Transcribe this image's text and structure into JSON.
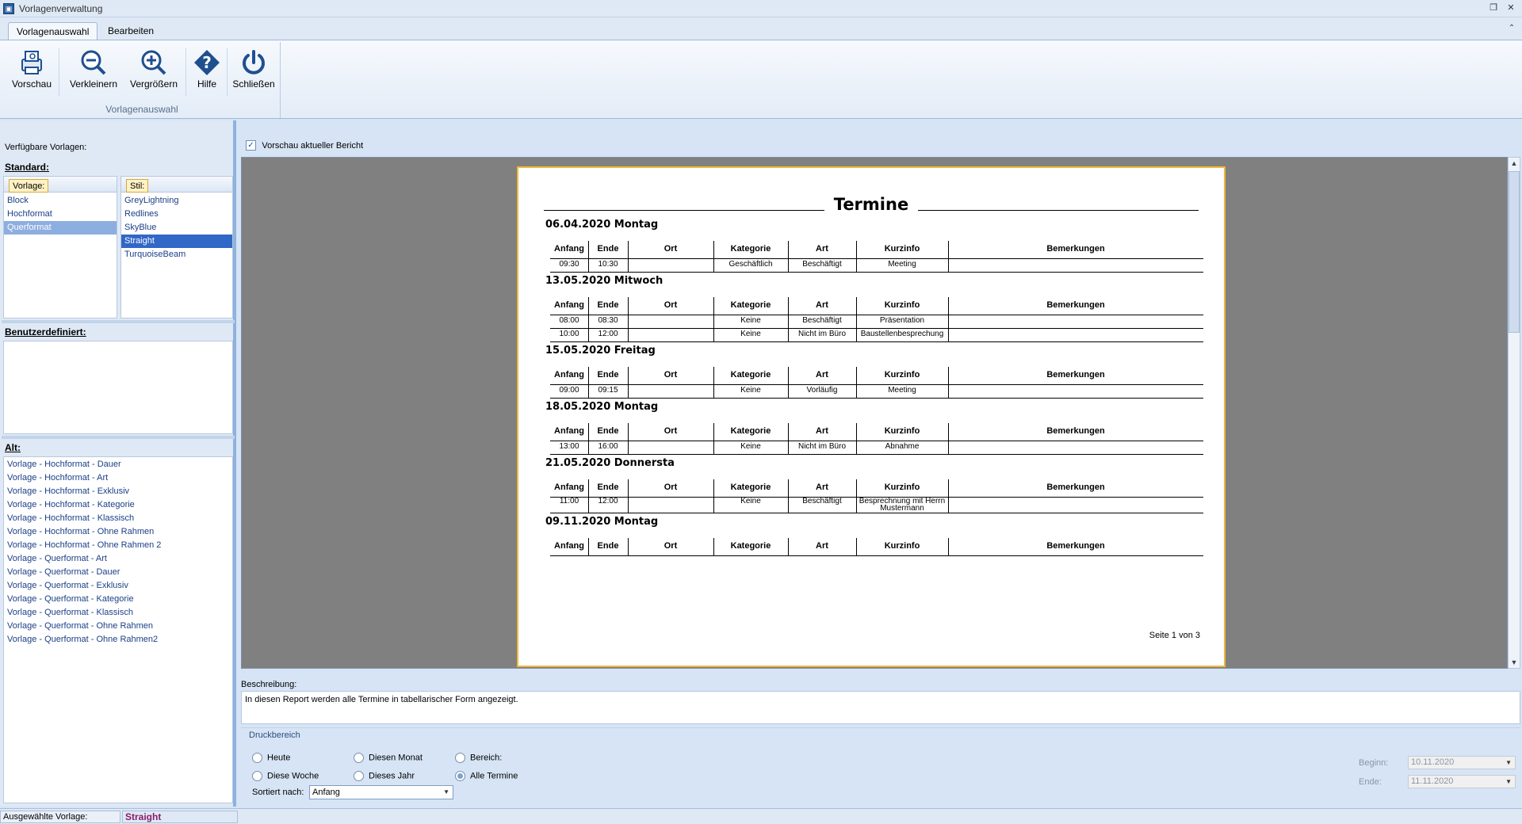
{
  "window": {
    "title": "Vorlagenverwaltung"
  },
  "tabs": [
    "Vorlagenauswahl",
    "Bearbeiten"
  ],
  "ribbon": {
    "buttons": [
      "Vorschau",
      "Verkleinern",
      "Vergrößern",
      "Hilfe",
      "Schließen"
    ],
    "group_label": "Vorlagenauswahl"
  },
  "left": {
    "available_label": "Verfügbare Vorlagen:",
    "standard_label": "Standard:",
    "vorlage_header": "Vorlage:",
    "stil_header": "Stil:",
    "vorlagen": [
      "Block",
      "Hochformat",
      "Querformat"
    ],
    "stile": [
      "GreyLightning",
      "Redlines",
      "SkyBlue",
      "Straight",
      "TurquoiseBeam"
    ],
    "custom_label": "Benutzerdefiniert:",
    "alt_label": "Alt:",
    "alt_items": [
      "Vorlage - Hochformat - Dauer",
      "Vorlage - Hochformat - Art",
      "Vorlage - Hochformat - Exklusiv",
      "Vorlage - Hochformat - Kategorie",
      "Vorlage - Hochformat - Klassisch",
      "Vorlage - Hochformat - Ohne Rahmen",
      "Vorlage - Hochformat - Ohne Rahmen 2",
      "Vorlage - Querformat - Art",
      "Vorlage - Querformat - Dauer",
      "Vorlage - Querformat - Exklusiv",
      "Vorlage - Querformat - Kategorie",
      "Vorlage - Querformat - Klassisch",
      "Vorlage - Querformat - Ohne Rahmen",
      "Vorlage - Querformat - Ohne Rahmen2"
    ]
  },
  "preview": {
    "checkbox_label": "Vorschau aktueller Bericht",
    "report": {
      "title": "Termine",
      "columns": [
        "Anfang",
        "Ende",
        "Ort",
        "Kategorie",
        "Art",
        "Kurzinfo",
        "Bemerkungen"
      ],
      "days": [
        {
          "date": "06.04.2020 Montag",
          "rows": [
            [
              "09:30",
              "10:30",
              "",
              "Geschäftlich",
              "Beschäftigt",
              "Meeting",
              ""
            ]
          ]
        },
        {
          "date": "13.05.2020 Mitwoch",
          "rows": [
            [
              "08:00",
              "08:30",
              "",
              "Keine",
              "Beschäftigt",
              "Präsentation",
              ""
            ],
            [
              "10:00",
              "12:00",
              "",
              "Keine",
              "Nicht im Büro",
              "Baustellenbesprechung",
              ""
            ]
          ]
        },
        {
          "date": "15.05.2020 Freitag",
          "rows": [
            [
              "09:00",
              "09:15",
              "",
              "Keine",
              "Vorläufig",
              "Meeting",
              ""
            ]
          ]
        },
        {
          "date": "18.05.2020 Montag",
          "rows": [
            [
              "13:00",
              "16:00",
              "",
              "Keine",
              "Nicht im Büro",
              "Abnahme",
              ""
            ]
          ]
        },
        {
          "date": "21.05.2020 Donnersta",
          "rows": [
            [
              "11:00",
              "12:00",
              "",
              "Keine",
              "Beschäftigt",
              "Besprechnung mit Herrn Mustermann",
              ""
            ]
          ]
        },
        {
          "date": "09.11.2020 Montag",
          "rows": []
        }
      ],
      "page_number": "Seite 1 von 3"
    }
  },
  "description": {
    "label": "Beschreibung:",
    "text": "In diesen Report werden alle Termine in tabellarischer Form angezeigt."
  },
  "print_range": {
    "label": "Druckbereich",
    "options": [
      "Heute",
      "Diese Woche",
      "Diesen Monat",
      "Dieses Jahr",
      "Bereich:",
      "Alle Termine"
    ],
    "selected": "Alle Termine",
    "sort_label": "Sortiert nach:",
    "sort_value": "Anfang",
    "begin_label": "Beginn:",
    "begin_value": "10.11.2020",
    "end_label": "Ende:",
    "end_value": "11.11.2020"
  },
  "status": {
    "label": "Ausgewählte Vorlage:",
    "value": "Straight"
  }
}
